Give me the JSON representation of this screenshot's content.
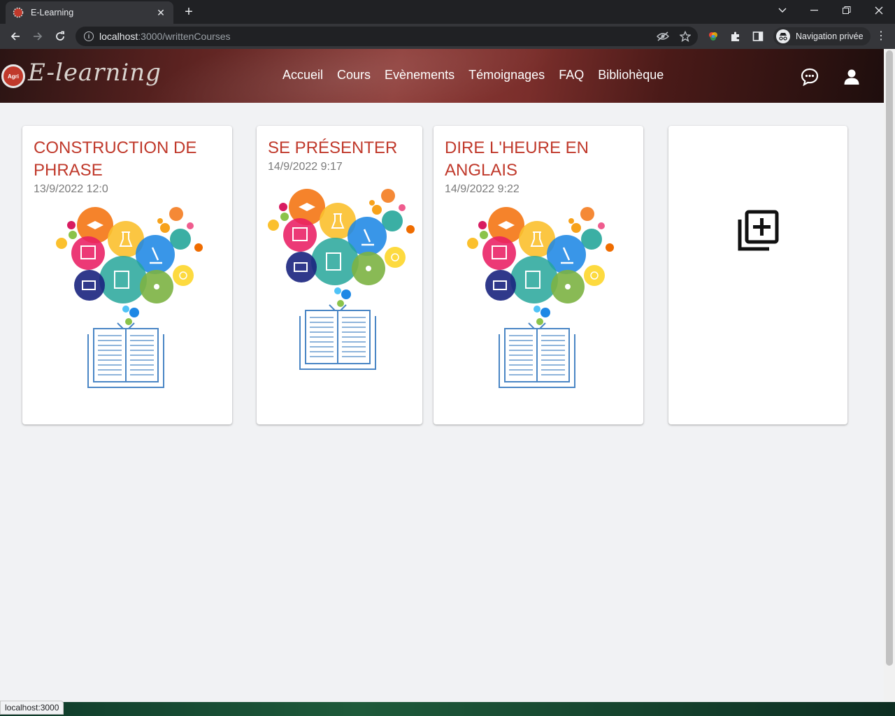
{
  "browser": {
    "tab_title": "E-Learning",
    "new_tab": "+",
    "url_host": "localhost",
    "url_path": ":3000/writtenCourses",
    "private_label": "Navigation privée",
    "status_text": "localhost:3000"
  },
  "header": {
    "logo_text": "E-learning",
    "logo_badge": "Agri",
    "nav": [
      "Accueil",
      "Cours",
      "Evènements",
      "Témoignages",
      "FAQ",
      "Bibliohèque"
    ]
  },
  "courses": [
    {
      "title": "CONSTRUCTION DE PHRASE",
      "date": "13/9/2022 12:0"
    },
    {
      "title": "SE PRÉSENTER",
      "date": "14/9/2022 9:17"
    },
    {
      "title": "DIRE L'HEURE EN ANGLAIS",
      "date": "14/9/2022 9:22"
    }
  ],
  "colors": {
    "accent": "#c0392b",
    "page_bg": "#f1f2f4"
  }
}
